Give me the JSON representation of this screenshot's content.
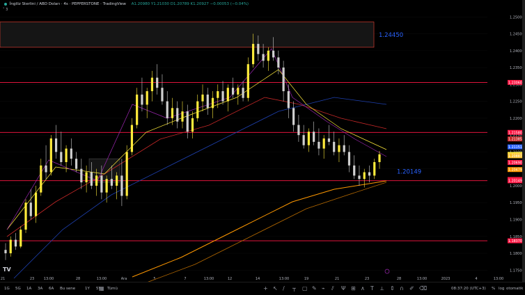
{
  "header": {
    "symbol": "İngiliz Sterlini / ABD Doları · 4s · PEPPERSTONE · TradingView",
    "ohlc": "A1.20980  Y1.21030  D1.20789  K1.20927  −0.00053 (−0.04%)",
    "indicator_toggle": "˅ 3"
  },
  "annotations": [
    {
      "text": "1.24450",
      "color": "#2962ff"
    },
    {
      "text": "1.20149",
      "color": "#2962ff"
    }
  ],
  "colors": {
    "bull": "#ffeb3b",
    "bear": "#9e9e9e",
    "support": "#ff1744",
    "zone_border": "#f44336",
    "ma_fast": "#ffeb3b",
    "ma_purple": "#9c27b0",
    "ma_red": "#c62828",
    "ma_blue": "#2962ff",
    "ma_orange": "#ff9800",
    "price_tag": "#ff1744"
  },
  "chart_data": {
    "type": "candlestick",
    "symbol": "GBPUSD",
    "ylim": [
      1.173,
      1.255
    ],
    "y_ticks": [
      "1.25000",
      "1.24500",
      "1.24000",
      "1.23500",
      "1.23000",
      "1.22500",
      "1.22000",
      "1.21500",
      "1.21000",
      "1.20500",
      "1.20000",
      "1.19500",
      "1.19000",
      "1.18500",
      "1.18000",
      "1.17500"
    ],
    "x_ticks": [
      "21",
      "23",
      "13:00",
      "28",
      "13:00",
      "Ara",
      "5",
      "7",
      "13:00",
      "12",
      "14",
      "13:00",
      "19",
      "21",
      "23",
      "28",
      "13:00",
      "2023",
      "4",
      "13:00"
    ],
    "zones": [
      {
        "from": 1.241,
        "to": 1.2485,
        "label": "1.24450"
      }
    ],
    "levels": [
      {
        "price": 1.2306,
        "tag": "1.23060"
      },
      {
        "price": 1.2158,
        "tag": "1.21580"
      },
      {
        "price": 1.20149,
        "tag": "1.20149"
      },
      {
        "price": 1.1837,
        "tag": "1.18370"
      }
    ],
    "price_tags": [
      {
        "price": 1.21385,
        "text": "1.21385",
        "bg": "#c62828"
      },
      {
        "price": 1.21151,
        "text": "1.21151",
        "bg": "#2962ff"
      },
      {
        "price": 1.20927,
        "text": "1.20927",
        "bg": "#ffeb3b"
      },
      {
        "price": 1.20887,
        "text": "1.20887",
        "bg": "#fbc02d"
      },
      {
        "price": 1.2069,
        "text": "1.20690",
        "bg": "#ff1744"
      },
      {
        "price": 1.20479,
        "text": "1.20479",
        "bg": "#ff9800"
      },
      {
        "price": 1.20185,
        "text": "1.20185",
        "bg": "#ff1744"
      },
      {
        "price": 1.20149,
        "text": "1.20149",
        "bg": "#ff1744"
      }
    ],
    "candles": [
      [
        1.181,
        1.183,
        1.178,
        1.18
      ],
      [
        1.18,
        1.185,
        1.179,
        1.184
      ],
      [
        1.184,
        1.186,
        1.181,
        1.182
      ],
      [
        1.182,
        1.188,
        1.1815,
        1.187
      ],
      [
        1.187,
        1.196,
        1.186,
        1.195
      ],
      [
        1.195,
        1.199,
        1.19,
        1.191
      ],
      [
        1.191,
        1.2,
        1.189,
        1.198
      ],
      [
        1.198,
        1.208,
        1.197,
        1.206
      ],
      [
        1.206,
        1.212,
        1.202,
        1.204
      ],
      [
        1.204,
        1.215,
        1.203,
        1.214
      ],
      [
        1.214,
        1.218,
        1.208,
        1.21
      ],
      [
        1.21,
        1.216,
        1.206,
        1.207
      ],
      [
        1.207,
        1.212,
        1.204,
        1.211
      ],
      [
        1.211,
        1.214,
        1.206,
        1.208
      ],
      [
        1.208,
        1.21,
        1.204,
        1.205
      ],
      [
        1.205,
        1.208,
        1.199,
        1.201
      ],
      [
        1.201,
        1.206,
        1.198,
        1.204
      ],
      [
        1.204,
        1.207,
        1.199,
        1.2
      ],
      [
        1.2,
        1.205,
        1.197,
        1.203
      ],
      [
        1.203,
        1.206,
        1.196,
        1.198
      ],
      [
        1.198,
        1.203,
        1.195,
        1.202
      ],
      [
        1.202,
        1.206,
        1.199,
        1.2
      ],
      [
        1.2,
        1.204,
        1.196,
        1.203
      ],
      [
        1.203,
        1.208,
        1.194,
        1.197
      ],
      [
        1.197,
        1.212,
        1.196,
        1.21
      ],
      [
        1.21,
        1.22,
        1.209,
        1.218
      ],
      [
        1.218,
        1.229,
        1.217,
        1.227
      ],
      [
        1.227,
        1.232,
        1.222,
        1.224
      ],
      [
        1.224,
        1.229,
        1.22,
        1.228
      ],
      [
        1.228,
        1.234,
        1.225,
        1.232
      ],
      [
        1.232,
        1.236,
        1.227,
        1.229
      ],
      [
        1.229,
        1.233,
        1.224,
        1.225
      ],
      [
        1.225,
        1.228,
        1.218,
        1.22
      ],
      [
        1.22,
        1.226,
        1.218,
        1.223
      ],
      [
        1.223,
        1.225,
        1.217,
        1.219
      ],
      [
        1.219,
        1.225,
        1.217,
        1.222
      ],
      [
        1.222,
        1.224,
        1.214,
        1.216
      ],
      [
        1.216,
        1.222,
        1.214,
        1.22
      ],
      [
        1.22,
        1.227,
        1.219,
        1.225
      ],
      [
        1.225,
        1.23,
        1.222,
        1.227
      ],
      [
        1.227,
        1.229,
        1.221,
        1.223
      ],
      [
        1.223,
        1.228,
        1.22,
        1.226
      ],
      [
        1.226,
        1.23,
        1.223,
        1.228
      ],
      [
        1.228,
        1.231,
        1.224,
        1.225
      ],
      [
        1.225,
        1.23,
        1.222,
        1.229
      ],
      [
        1.229,
        1.232,
        1.226,
        1.227
      ],
      [
        1.227,
        1.23,
        1.224,
        1.229
      ],
      [
        1.229,
        1.231,
        1.225,
        1.226
      ],
      [
        1.226,
        1.238,
        1.225,
        1.236
      ],
      [
        1.236,
        1.245,
        1.235,
        1.242
      ],
      [
        1.242,
        1.2445,
        1.237,
        1.239
      ],
      [
        1.239,
        1.242,
        1.235,
        1.237
      ],
      [
        1.237,
        1.241,
        1.234,
        1.24
      ],
      [
        1.24,
        1.244,
        1.237,
        1.238
      ],
      [
        1.238,
        1.24,
        1.233,
        1.235
      ],
      [
        1.235,
        1.237,
        1.225,
        1.228
      ],
      [
        1.228,
        1.23,
        1.22,
        1.223
      ],
      [
        1.223,
        1.225,
        1.216,
        1.218
      ],
      [
        1.218,
        1.221,
        1.213,
        1.215
      ],
      [
        1.215,
        1.218,
        1.211,
        1.212
      ],
      [
        1.212,
        1.217,
        1.21,
        1.216
      ],
      [
        1.216,
        1.219,
        1.212,
        1.213
      ],
      [
        1.213,
        1.217,
        1.209,
        1.211
      ],
      [
        1.211,
        1.215,
        1.208,
        1.214
      ],
      [
        1.214,
        1.218,
        1.212,
        1.213
      ],
      [
        1.213,
        1.216,
        1.209,
        1.21
      ],
      [
        1.21,
        1.214,
        1.207,
        1.212
      ],
      [
        1.212,
        1.215,
        1.209,
        1.21
      ],
      [
        1.21,
        1.212,
        1.204,
        1.206
      ],
      [
        1.206,
        1.209,
        1.202,
        1.203
      ],
      [
        1.203,
        1.206,
        1.2,
        1.202
      ],
      [
        1.202,
        1.205,
        1.1995,
        1.204
      ],
      [
        1.204,
        1.206,
        1.201,
        1.203
      ],
      [
        1.203,
        1.208,
        1.202,
        1.207
      ],
      [
        1.207,
        1.2103,
        1.205,
        1.2093
      ]
    ]
  },
  "toolbar": {
    "timeframes": [
      "1G",
      "5G",
      "1A",
      "3A",
      "6A",
      "Bu sene",
      "1Y",
      "5Y",
      "Tümü"
    ],
    "clock": "08:37:20 (UTC+3)",
    "pct": "%",
    "log": "log",
    "auto": "otomatik"
  }
}
